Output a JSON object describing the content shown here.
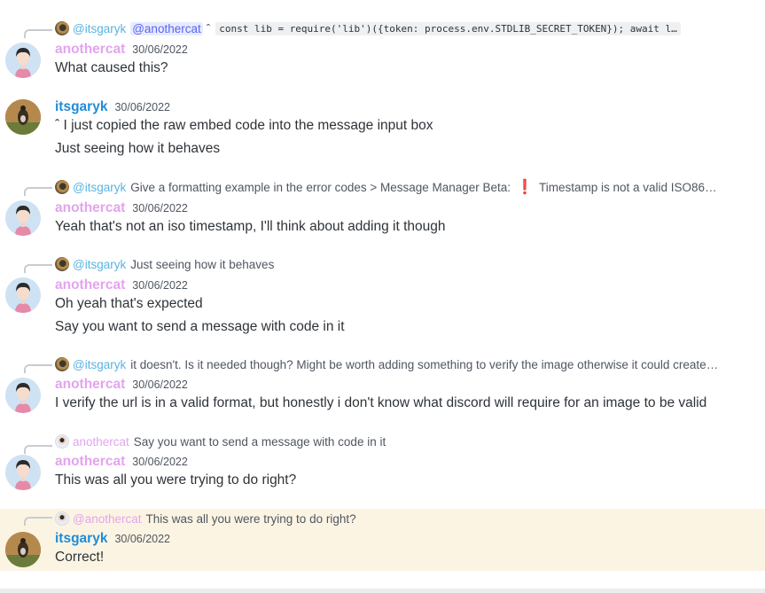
{
  "users": {
    "cat": "anothercat",
    "gary": "itsgaryk"
  },
  "messages": [
    {
      "reply": {
        "author": "@itsgaryk",
        "mention": "@anothercat",
        "caret": "ˆ",
        "code": "const lib = require('lib')({token: process.env.STDLIB_SECRET_TOKEN});  await l…"
      },
      "author": "anothercat",
      "timestamp": "30/06/2022",
      "lines": [
        "What caused this?"
      ]
    },
    {
      "author": "itsgaryk",
      "timestamp": "30/06/2022",
      "lines": [
        "ˆ I just copied the raw embed code into the message input box",
        "Just seeing how it behaves"
      ]
    },
    {
      "reply": {
        "author": "@itsgaryk",
        "text": "Give a formatting example in the error codes > Message Manager Beta:",
        "emoji": "❗",
        "text2": "Timestamp is not a valid ISO8601 ti…"
      },
      "author": "anothercat",
      "timestamp": "30/06/2022",
      "lines": [
        "Yeah that's not an iso timestamp, I'll think about adding it though"
      ]
    },
    {
      "reply": {
        "author": "@itsgaryk",
        "text": "Just seeing how it behaves"
      },
      "author": "anothercat",
      "timestamp": "30/06/2022",
      "lines": [
        "Oh yeah that's expected",
        "Say you want to send a message with code in it"
      ]
    },
    {
      "reply": {
        "author": "@itsgaryk",
        "text": "it doesn't. Is it needed though? Might be worth adding something to verify the image otherwise it could create n…"
      },
      "author": "anothercat",
      "timestamp": "30/06/2022",
      "lines": [
        "I verify the url is in a valid format, but honestly i don't know what discord will require for an image to be valid"
      ]
    },
    {
      "reply": {
        "author": "anothercat",
        "text": "Say you want to send a message with code in it"
      },
      "author": "anothercat",
      "timestamp": "30/06/2022",
      "lines": [
        "This was all you were trying to do right?"
      ]
    },
    {
      "reply": {
        "author": "@anothercat",
        "text": "This was all you were trying to do right?"
      },
      "author": "itsgaryk",
      "timestamp": "30/06/2022",
      "lines": [
        "Correct!"
      ],
      "highlighted": true
    }
  ]
}
